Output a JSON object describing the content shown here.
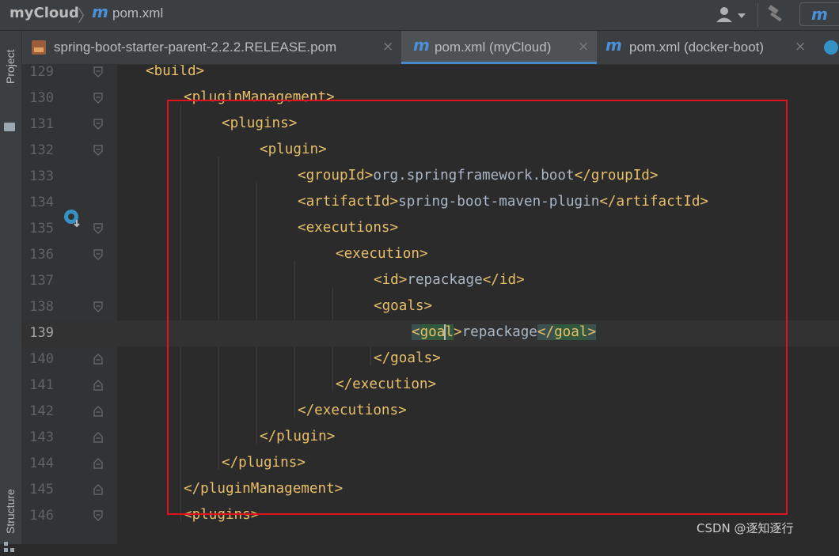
{
  "navbar": {
    "project": "myCloud",
    "file": "pom.xml",
    "maven_glyph": "m"
  },
  "tool_windows": {
    "project": "Project",
    "structure": "Structure"
  },
  "tabs": [
    {
      "label": "spring-boot-starter-parent-2.2.2.RELEASE.pom",
      "icon": "xml-file-icon",
      "active": false
    },
    {
      "label": "pom.xml (myCloud)",
      "icon": "maven-icon",
      "active": true
    },
    {
      "label": "pom.xml (docker-boot)",
      "icon": "maven-icon",
      "active": false
    }
  ],
  "editor": {
    "current_line": "139",
    "lines": [
      {
        "n": "129",
        "code": "<build>"
      },
      {
        "n": "130",
        "code": "<pluginManagement>"
      },
      {
        "n": "131",
        "code": "<plugins>"
      },
      {
        "n": "132",
        "code": "<plugin>"
      },
      {
        "n": "133",
        "open": "<groupId>",
        "text": "org.springframework.boot",
        "close": "</groupId>"
      },
      {
        "n": "134",
        "open": "<artifactId>",
        "text": "spring-boot-maven-plugin",
        "close": "</artifactId>"
      },
      {
        "n": "135",
        "code": "<executions>"
      },
      {
        "n": "136",
        "code": "<execution>"
      },
      {
        "n": "137",
        "open": "<id>",
        "text": "repackage",
        "close": "</id>"
      },
      {
        "n": "138",
        "code": "<goals>"
      },
      {
        "n": "139",
        "open_lt": "<",
        "open_name": "goal",
        "open_gt": ">",
        "text": "repackage",
        "close_lt": "</",
        "close_name": "goal",
        "close_gt": ">"
      },
      {
        "n": "140",
        "code": "</goals>"
      },
      {
        "n": "141",
        "code": "</execution>"
      },
      {
        "n": "142",
        "code": "</executions>"
      },
      {
        "n": "143",
        "code": "</plugin>"
      },
      {
        "n": "144",
        "code": "</plugins>"
      },
      {
        "n": "145",
        "code": "</pluginManagement>"
      },
      {
        "n": "146",
        "code": "<plugins>"
      }
    ]
  },
  "watermark": "CSDN @逐知逐行",
  "colors": {
    "tag": "#e8bf6a",
    "text": "#a9b7c6",
    "highlight_box": "#e0141e",
    "tab_underline": "#4a88c7"
  }
}
